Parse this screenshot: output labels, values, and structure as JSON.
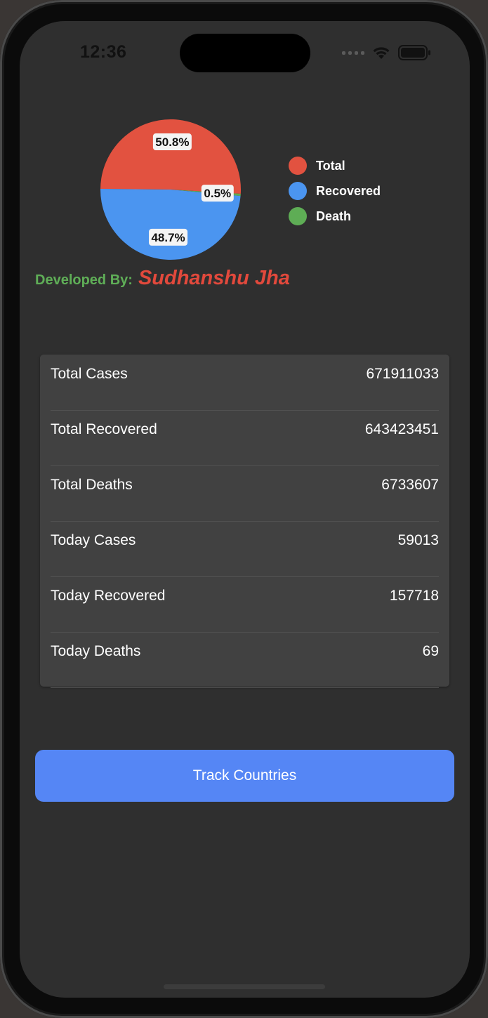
{
  "status_bar": {
    "time": "12:36",
    "icons": [
      "signal-dots",
      "wifi-icon",
      "battery-icon"
    ]
  },
  "chart_data": {
    "type": "pie",
    "slices": [
      {
        "name": "Total",
        "value": 50.8,
        "label": "50.8%",
        "color": "#e25240"
      },
      {
        "name": "Recovered",
        "value": 48.7,
        "label": "48.7%",
        "color": "#4b95f0"
      },
      {
        "name": "Death",
        "value": 0.5,
        "label": "0.5%",
        "color": "#5ead55"
      }
    ],
    "legend": {
      "placement": "right",
      "items": [
        {
          "label": "Total",
          "color": "#e25240"
        },
        {
          "label": "Recovered",
          "color": "#4b95f0"
        },
        {
          "label": "Death",
          "color": "#5ead55"
        }
      ]
    }
  },
  "developer": {
    "label": "Developed By:",
    "name": "Sudhanshu Jha"
  },
  "stats": [
    {
      "label": "Total Cases",
      "value": "671911033"
    },
    {
      "label": "Total Recovered",
      "value": "643423451"
    },
    {
      "label": "Total Deaths",
      "value": "6733607"
    },
    {
      "label": "Today Cases",
      "value": "59013"
    },
    {
      "label": "Today Recovered",
      "value": "157718"
    },
    {
      "label": "Today Deaths",
      "value": "69"
    }
  ],
  "actions": {
    "track_countries": "Track Countries"
  },
  "colors": {
    "background": "#2f2f2f",
    "card": "#414141",
    "accent": "#5586f5",
    "developer_label": "#5fae57",
    "developer_name": "#e2493c"
  }
}
